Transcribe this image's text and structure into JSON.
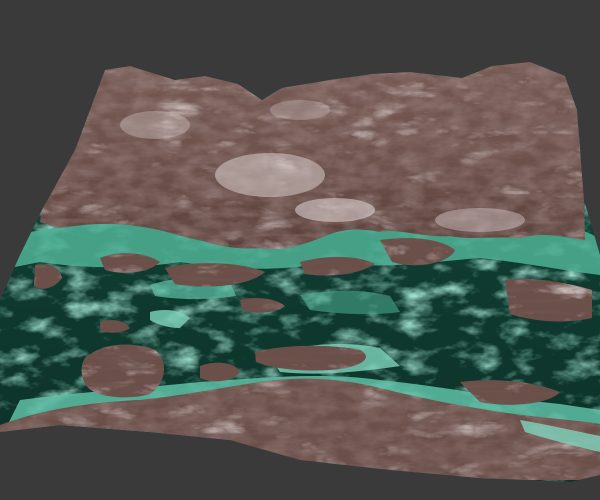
{
  "scene": {
    "background_color": "#3a3a3a",
    "subject": "terrain-heightmap",
    "colors": {
      "rock_base": "#6b4f49",
      "rock_light": "#c9bcbb",
      "rock_dark": "#3b2522",
      "rock_rust": "#8a4b3e",
      "water_deep": "#0f3a2f",
      "water_mid": "#155a48",
      "water_shallow": "#5fc0a6",
      "foam": "#9be3cf"
    }
  }
}
